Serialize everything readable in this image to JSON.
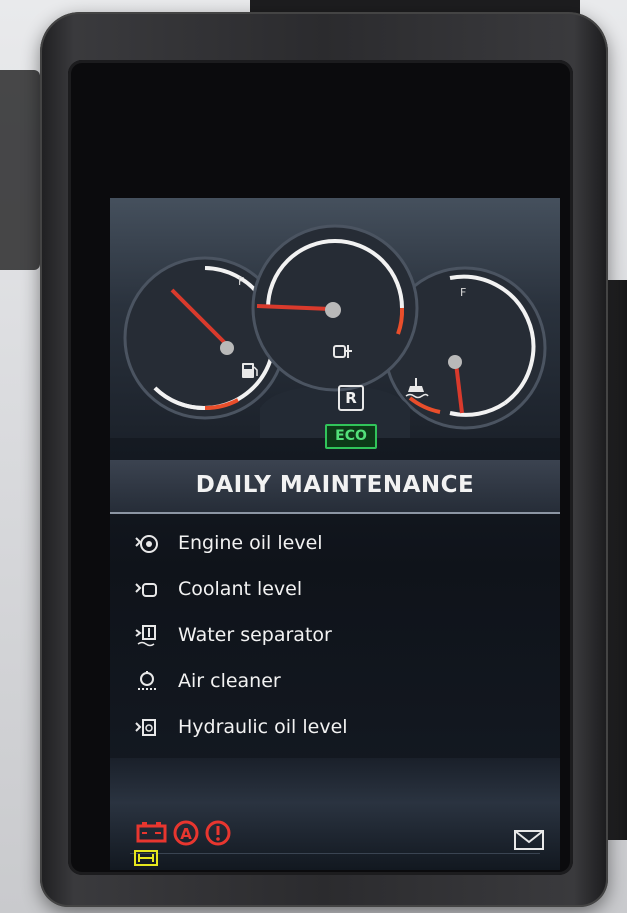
{
  "gauges": {
    "left_full_mark": "F",
    "right_full_mark": "F",
    "gear": "R",
    "mode": "ECO"
  },
  "header": {
    "title": "DAILY MAINTENANCE"
  },
  "maintenance_items": [
    {
      "label": "Engine oil level",
      "icon": "engine-oil-icon"
    },
    {
      "label": "Coolant level",
      "icon": "coolant-icon"
    },
    {
      "label": "Water separator",
      "icon": "water-separator-icon"
    },
    {
      "label": "Air cleaner",
      "icon": "air-cleaner-icon"
    },
    {
      "label": "Hydraulic oil level",
      "icon": "hydraulic-oil-icon"
    }
  ],
  "status_icons": [
    "battery-warning-icon",
    "auto-brake-icon",
    "general-warning-icon",
    "mail-icon",
    "yellow-indicator-icon"
  ],
  "colors": {
    "warning": "#e8362f",
    "eco": "#31c45a",
    "yellow": "#e6e61e",
    "needle": "#d93a2c"
  }
}
